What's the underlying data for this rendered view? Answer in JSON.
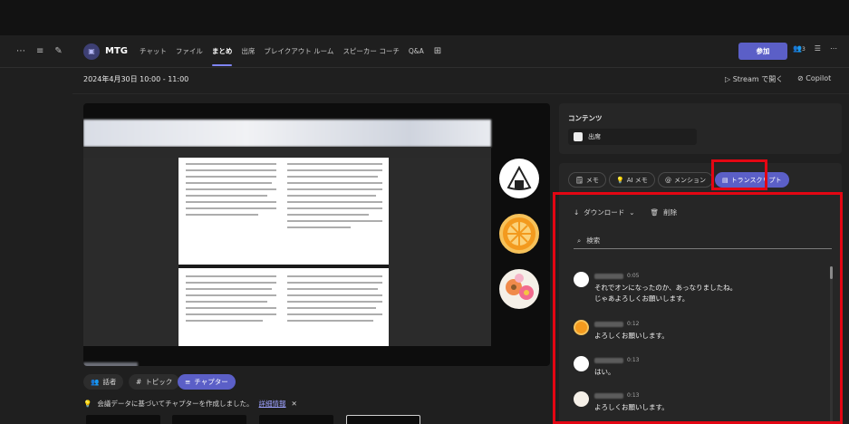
{
  "header": {
    "title": "MTG",
    "tabs": [
      "チャット",
      "ファイル",
      "まとめ",
      "出席",
      "ブレイクアウト ルーム",
      "スピーカー コーチ",
      "Q&A"
    ],
    "active_tab": "まとめ",
    "join_label": "参加",
    "participant_count": "3"
  },
  "meeting": {
    "date": "2024年4月30日 10:00 - 11:00",
    "stream_label": "Stream で開く",
    "copilot_label": "Copilot"
  },
  "recap_chips": {
    "speakers": "話者",
    "topics": "トピック",
    "chapters": "チャプター"
  },
  "notice": {
    "text": "会議データに基づいてチャプターを作成しました。",
    "link": "詳細情報"
  },
  "content_panel": {
    "title": "コンテンツ",
    "item": "出席"
  },
  "side_tabs": {
    "notes": "メモ",
    "ai_notes": "AI メモ",
    "mentions": "メンション",
    "transcript": "トランスクリプト"
  },
  "transcript": {
    "download": "ダウンロード",
    "delete": "削除",
    "search_placeholder": "検索",
    "entries": [
      {
        "time": "0:05",
        "line1": "それでオンになったのか、あっなりましたね。",
        "line2": "じゃあよろしくお願いします。"
      },
      {
        "time": "0:12",
        "line1": "よろしくお願いします。",
        "line2": ""
      },
      {
        "time": "0:13",
        "line1": "はい。",
        "line2": ""
      },
      {
        "time": "0:13",
        "line1": "よろしくお願いします。",
        "line2": ""
      }
    ]
  },
  "colors": {
    "accent": "#5b5fc7",
    "highlight": "#e30613"
  },
  "icons": [
    "ellipsis-icon",
    "filter-icon",
    "compose-icon",
    "meeting-icon",
    "add-tab-icon",
    "people-icon",
    "list-icon",
    "stream-icon",
    "copilot-icon",
    "download-icon",
    "chevron-down-icon",
    "trash-icon",
    "search-icon",
    "lightbulb-icon",
    "close-icon"
  ]
}
